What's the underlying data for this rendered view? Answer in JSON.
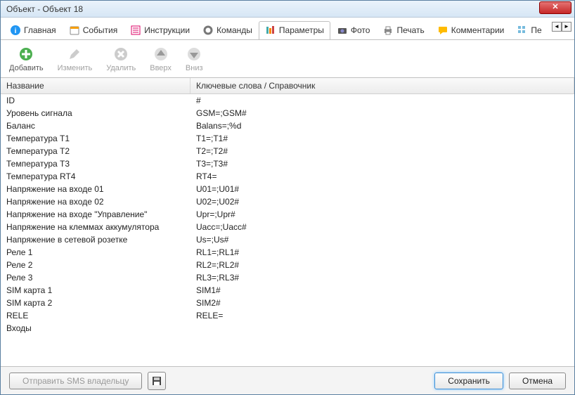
{
  "window": {
    "title": "Объект - Объект 18"
  },
  "tabs": {
    "items": [
      {
        "label": "Главная"
      },
      {
        "label": "События"
      },
      {
        "label": "Инструкции"
      },
      {
        "label": "Команды"
      },
      {
        "label": "Параметры"
      },
      {
        "label": "Фото"
      },
      {
        "label": "Печать"
      },
      {
        "label": "Комментарии"
      },
      {
        "label": "Пе"
      }
    ],
    "active_index": 4
  },
  "toolbar": {
    "add": "Добавить",
    "edit": "Изменить",
    "delete": "Удалить",
    "up": "Вверх",
    "down": "Вниз"
  },
  "grid": {
    "header_name": "Название",
    "header_keys": "Ключевые слова / Справочник",
    "rows": [
      {
        "name": "ID",
        "keys": "#"
      },
      {
        "name": "Уровень сигнала",
        "keys": "GSM=;GSM#"
      },
      {
        "name": "Баланс",
        "keys": "Balans=;%d"
      },
      {
        "name": "Температура T1",
        "keys": "T1=;T1#"
      },
      {
        "name": "Температура T2",
        "keys": "T2=;T2#"
      },
      {
        "name": "Температура T3",
        "keys": "T3=;T3#"
      },
      {
        "name": "Температура RT4",
        "keys": "RT4="
      },
      {
        "name": "Напряжение на входе 01",
        "keys": "U01=;U01#"
      },
      {
        "name": "Напряжение на входе 02",
        "keys": "U02=;U02#"
      },
      {
        "name": "Напряжение на входе \"Управление\"",
        "keys": "Upr=;Upr#"
      },
      {
        "name": "Напряжение на клеммах аккумулятора",
        "keys": "Uacc=;Uacc#"
      },
      {
        "name": "Напряжение в сетевой розетке",
        "keys": "Us=;Us#"
      },
      {
        "name": "Реле 1",
        "keys": "RL1=;RL1#"
      },
      {
        "name": "Реле 2",
        "keys": "RL2=;RL2#"
      },
      {
        "name": "Реле 3",
        "keys": "RL3=;RL3#"
      },
      {
        "name": "SIM карта 1",
        "keys": "SIM1#"
      },
      {
        "name": "SIM карта 2",
        "keys": "SIM2#"
      },
      {
        "name": "RELE",
        "keys": "RELE="
      },
      {
        "name": "Входы",
        "keys": ""
      }
    ]
  },
  "footer": {
    "send_sms": "Отправить SMS владельцу",
    "save": "Сохранить",
    "cancel": "Отмена"
  }
}
